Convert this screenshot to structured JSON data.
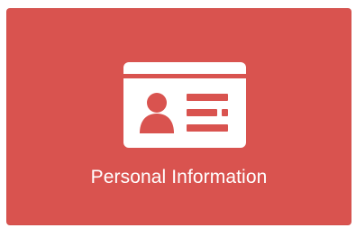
{
  "tile": {
    "label": "Personal Information",
    "icon": "id-card-icon",
    "accent": "#d9534f"
  }
}
